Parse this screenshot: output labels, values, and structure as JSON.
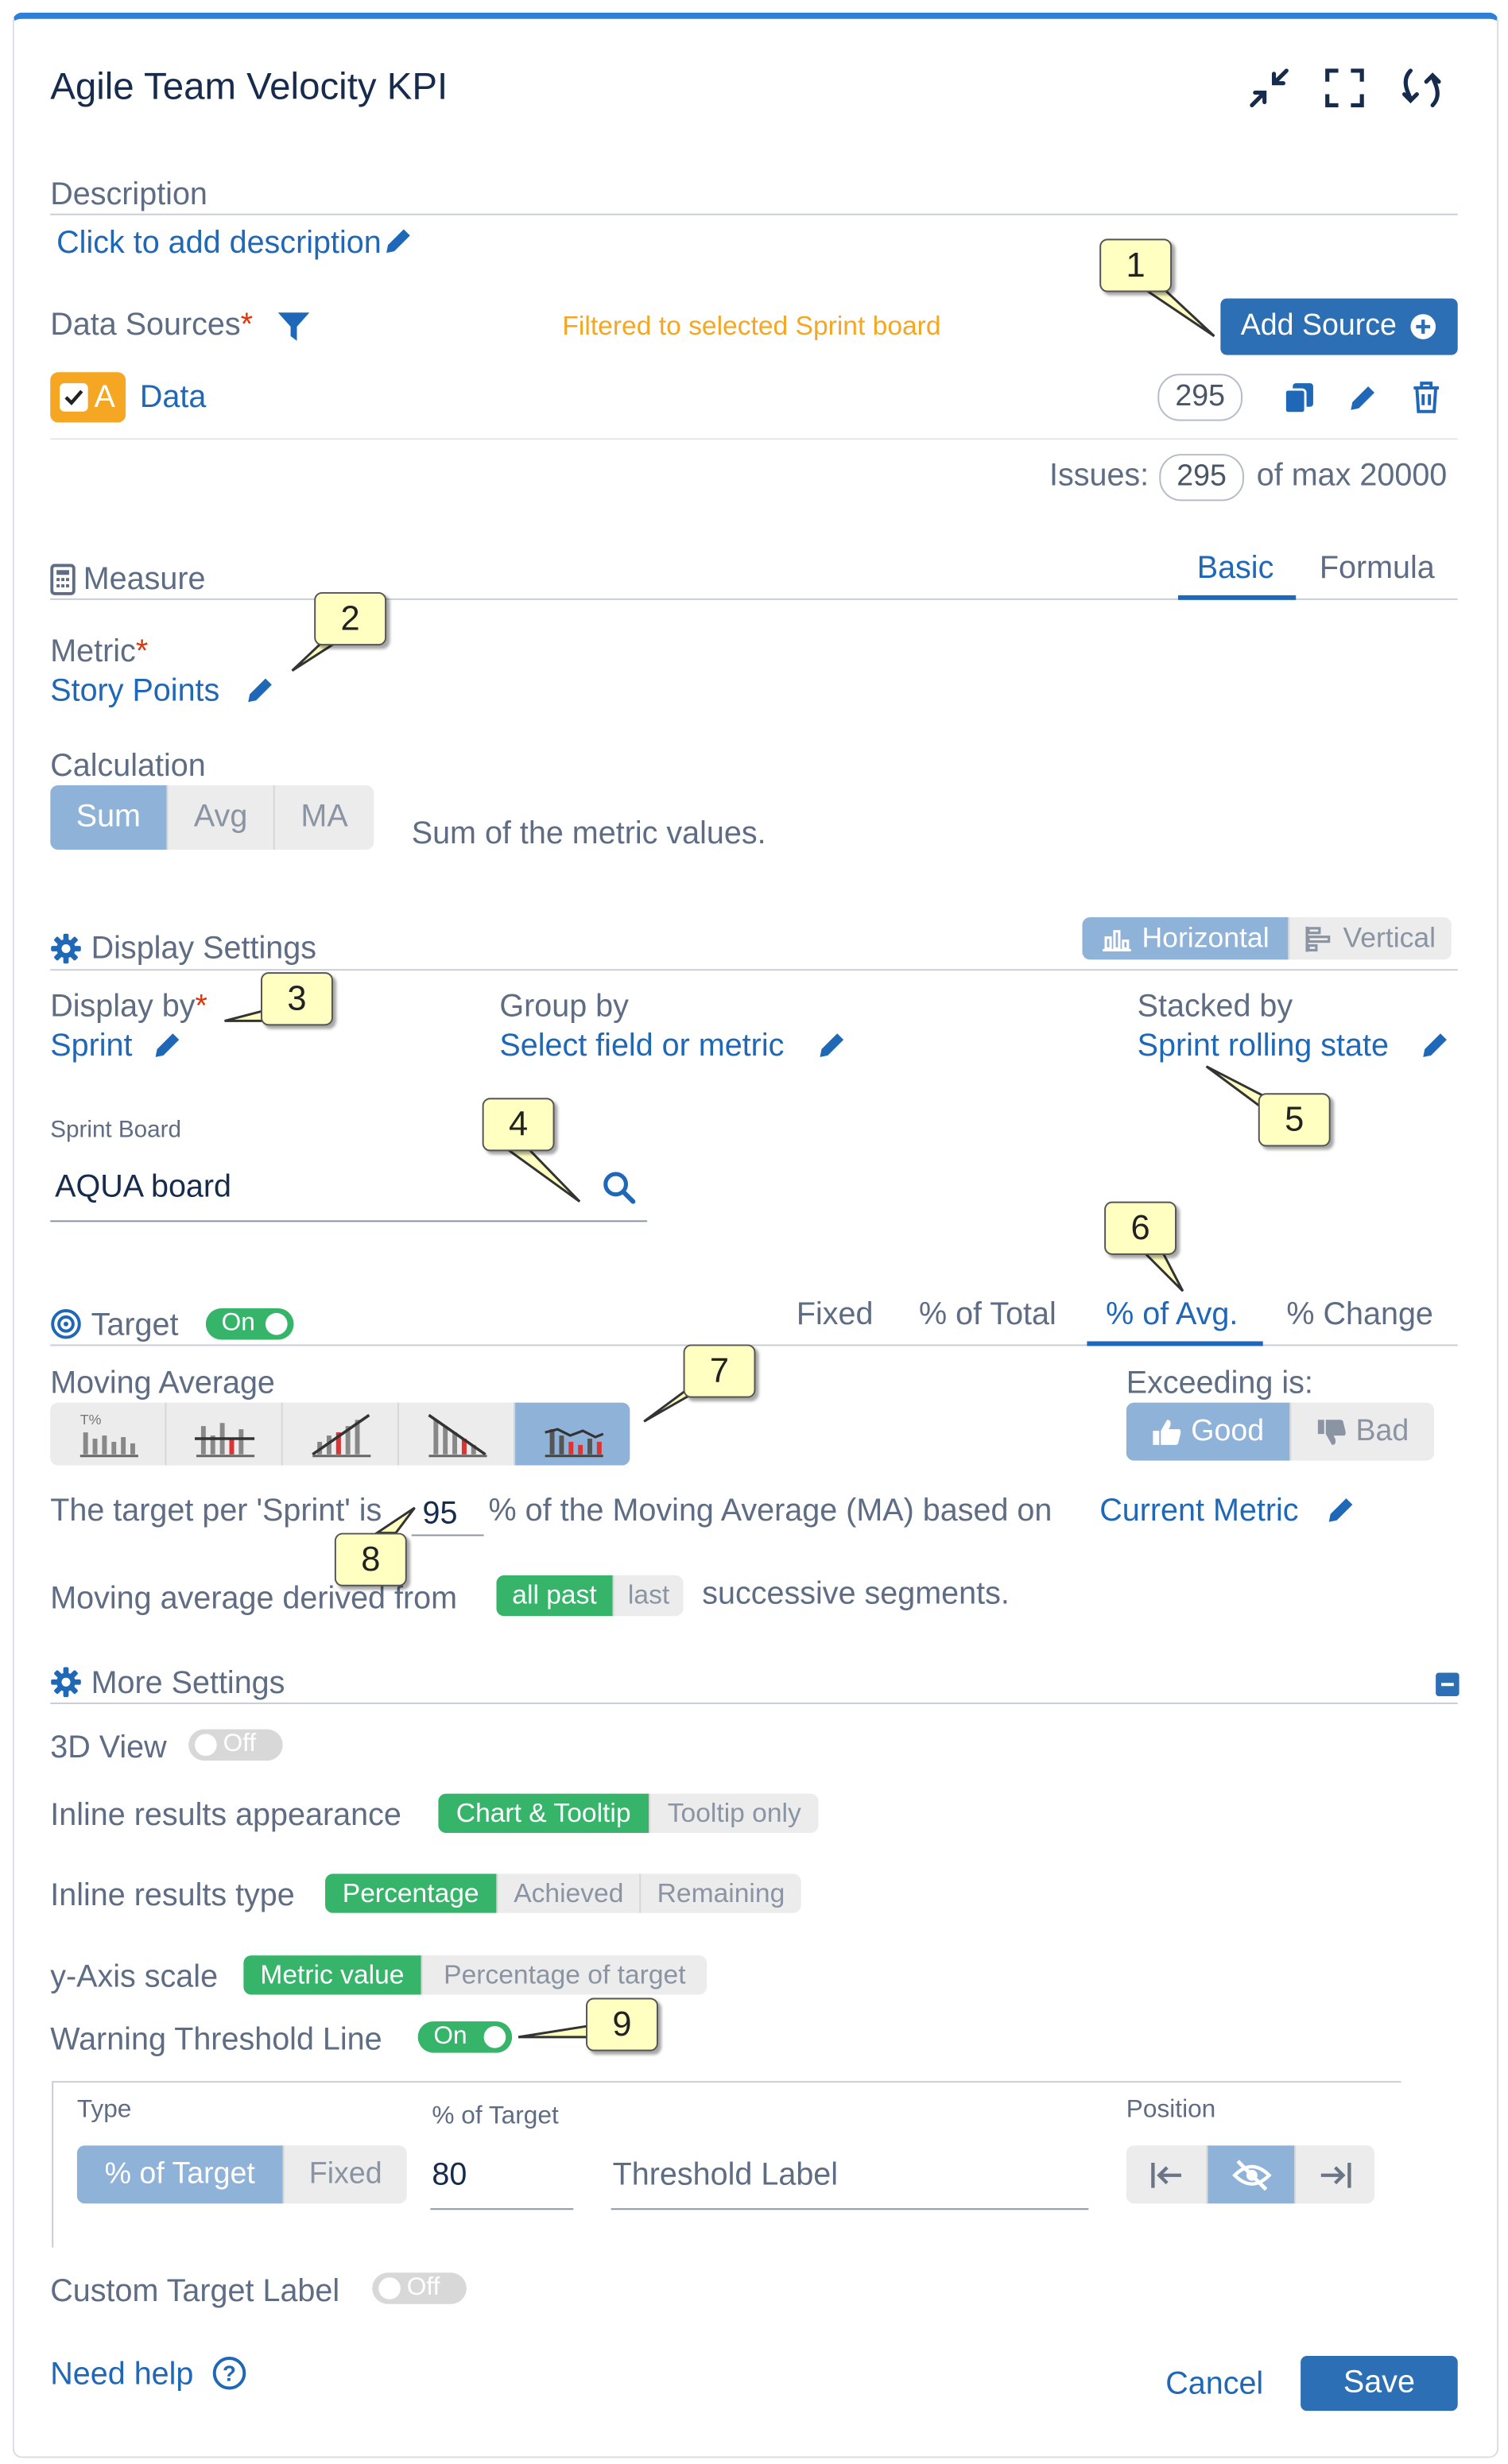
{
  "header": {
    "title": "Agile Team Velocity KPI"
  },
  "description": {
    "label": "Description",
    "placeholder": "Click to add description"
  },
  "data_sources": {
    "label": "Data Sources",
    "required_mark": "*",
    "filter_note": "Filtered to selected Sprint board",
    "add_button": "Add Source",
    "source": {
      "letter": "A",
      "name": "Data",
      "count": "295"
    },
    "issues_label": "Issues:",
    "issues_count": "295",
    "issues_max": "of max 20000"
  },
  "measure": {
    "label": "Measure",
    "tabs": [
      "Basic",
      "Formula"
    ],
    "metric_label": "Metric",
    "required_mark": "*",
    "metric_value": "Story Points",
    "calculation_label": "Calculation",
    "calc_options": [
      "Sum",
      "Avg",
      "MA"
    ],
    "calc_selected": "Sum",
    "calc_description": "Sum of the metric values."
  },
  "display_settings": {
    "label": "Display Settings",
    "orientation": [
      "Horizontal",
      "Vertical"
    ],
    "display_by_label": "Display by",
    "required_mark": "*",
    "display_by_value": "Sprint",
    "group_by_label": "Group by",
    "group_by_value": "Select field or metric",
    "stacked_by_label": "Stacked by",
    "stacked_by_value": "Sprint rolling state",
    "sprint_board_label": "Sprint Board",
    "sprint_board_value": "AQUA board"
  },
  "target": {
    "label": "Target",
    "toggle": "On",
    "tabs": [
      "Fixed",
      "% of Total",
      "% of Avg.",
      "% Change"
    ],
    "active_tab": "% of Avg.",
    "moving_average_label": "Moving Average",
    "exceeding_label": "Exceeding is:",
    "exceeding_options": [
      "Good",
      "Bad"
    ],
    "exceeding_selected": "Good",
    "sentence_prefix": "The target per 'Sprint' is",
    "percent_value": "95",
    "sentence_middle": "% of the Moving Average (MA) based on",
    "based_on": "Current Metric",
    "derived_prefix": "Moving average derived from",
    "derived_options": [
      "all past",
      "last"
    ],
    "derived_selected": "all past",
    "derived_suffix": "successive segments."
  },
  "more_settings": {
    "label": "More Settings",
    "view3d_label": "3D View",
    "view3d_toggle": "Off",
    "inline_appearance_label": "Inline results appearance",
    "inline_appearance_options": [
      "Chart & Tooltip",
      "Tooltip only"
    ],
    "inline_type_label": "Inline results type",
    "inline_type_options": [
      "Percentage",
      "Achieved",
      "Remaining"
    ],
    "yaxis_label": "y-Axis scale",
    "yaxis_options": [
      "Metric value",
      "Percentage of target"
    ],
    "warning_label": "Warning Threshold Line",
    "warning_toggle": "On",
    "threshold": {
      "type_label": "Type",
      "type_options": [
        "% of Target",
        "Fixed"
      ],
      "percent_label": "% of Target",
      "percent_value": "80",
      "label_placeholder": "Threshold Label",
      "position_label": "Position"
    },
    "custom_target_label": "Custom Target Label",
    "custom_target_toggle": "Off"
  },
  "footer": {
    "help": "Need help",
    "cancel": "Cancel",
    "save": "Save"
  },
  "callouts": [
    "1",
    "2",
    "3",
    "4",
    "5",
    "6",
    "7",
    "8",
    "9"
  ],
  "colors": {
    "accent": "#1f68b8",
    "primary_button": "#2d6fb5",
    "green": "#36b56a",
    "warning": "#f5a623",
    "callout_fill": "#ffffc2"
  }
}
